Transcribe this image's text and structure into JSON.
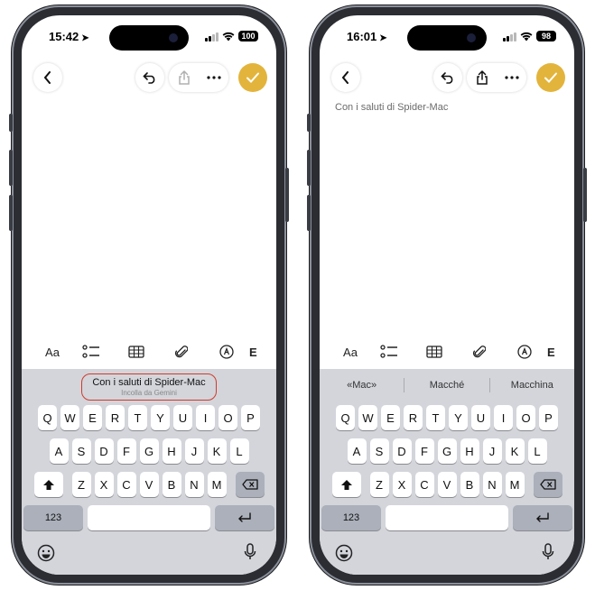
{
  "phones": [
    {
      "status": {
        "time": "15:42",
        "battery": "100"
      },
      "note_text": "",
      "suggestions": {
        "type": "clipboard",
        "main": "Con i saluti di Spider-Mac",
        "sub": "Incolla da Gemini"
      }
    },
    {
      "status": {
        "time": "16:01",
        "battery": "98"
      },
      "note_text": "Con i saluti di Spider-Mac",
      "suggestions": {
        "type": "words",
        "words": [
          "«Mac»",
          "Macché",
          "Macchina"
        ]
      }
    }
  ],
  "format_bar": {
    "text_style_label": "Aa"
  },
  "keyboard": {
    "row1": [
      "Q",
      "W",
      "E",
      "R",
      "T",
      "Y",
      "U",
      "I",
      "O",
      "P"
    ],
    "row2": [
      "A",
      "S",
      "D",
      "F",
      "G",
      "H",
      "J",
      "K",
      "L"
    ],
    "row3": [
      "Z",
      "X",
      "C",
      "V",
      "B",
      "N",
      "M"
    ],
    "numbers_label": "123"
  },
  "icons": {
    "back": "chevron-left-icon",
    "undo": "undo-icon",
    "share": "share-icon",
    "more": "ellipsis-icon",
    "done": "checkmark-icon",
    "checklist": "checklist-icon",
    "table": "table-icon",
    "attach": "paperclip-icon",
    "markup": "markup-pen-icon",
    "shift": "shift-icon",
    "delete": "delete-icon",
    "return": "return-icon",
    "emoji": "emoji-icon",
    "mic": "microphone-icon"
  },
  "colors": {
    "accent": "#e3b43c",
    "highlight_border": "#d23a2a",
    "keyboard_bg": "#d3d5db"
  }
}
